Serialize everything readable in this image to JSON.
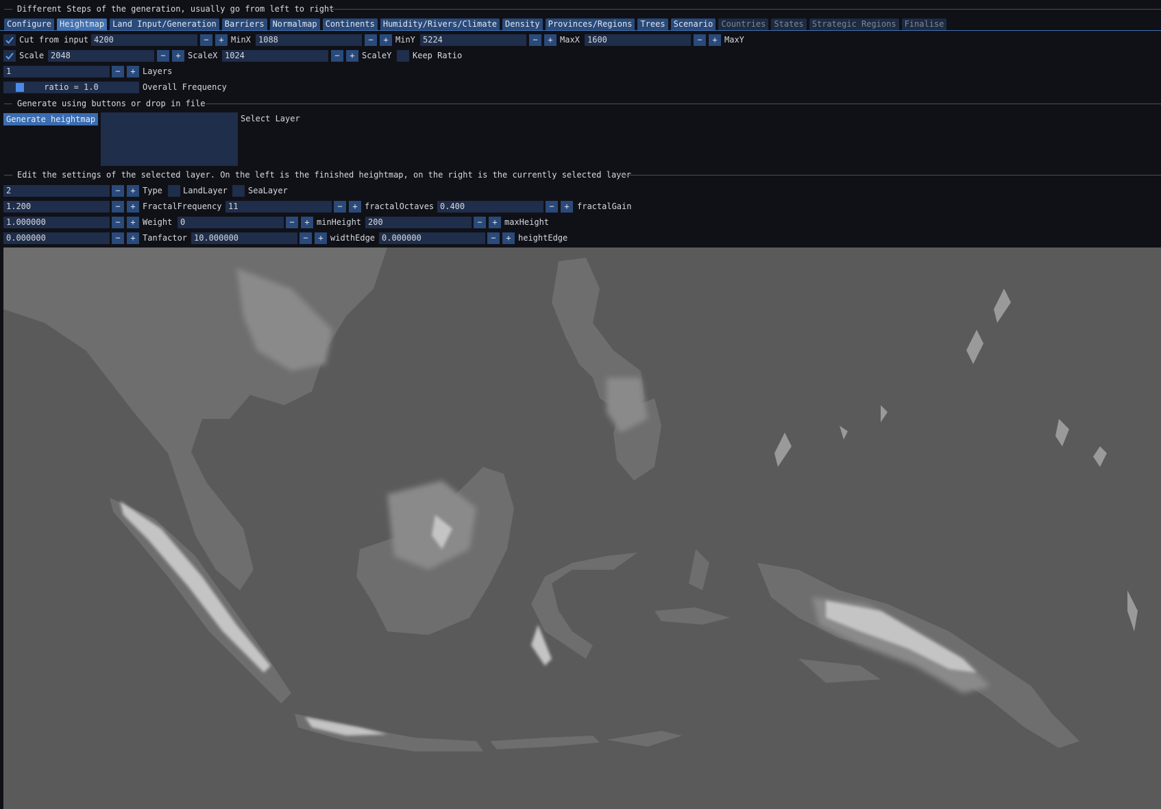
{
  "sections": {
    "steps": "Different Steps of the generation, usually go from left to right",
    "generate": "Generate using buttons or drop in file",
    "edit": "Edit the settings of the selected layer. On the left is the finished heightmap, on the right is the currently selected layer"
  },
  "tabs": [
    {
      "label": "Configure",
      "state": "enabled"
    },
    {
      "label": "Heightmap",
      "state": "active"
    },
    {
      "label": "Land Input/Generation",
      "state": "enabled"
    },
    {
      "label": "Barriers",
      "state": "enabled"
    },
    {
      "label": "Normalmap",
      "state": "enabled"
    },
    {
      "label": "Continents",
      "state": "enabled"
    },
    {
      "label": "Humidity/Rivers/Climate",
      "state": "enabled"
    },
    {
      "label": "Density",
      "state": "enabled"
    },
    {
      "label": "Provinces/Regions",
      "state": "enabled"
    },
    {
      "label": "Trees",
      "state": "enabled"
    },
    {
      "label": "Scenario",
      "state": "enabled"
    },
    {
      "label": "Countries",
      "state": "disabled"
    },
    {
      "label": "States",
      "state": "disabled"
    },
    {
      "label": "Strategic Regions",
      "state": "disabled"
    },
    {
      "label": "Finalise",
      "state": "disabled"
    }
  ],
  "buttons": {
    "minus": "−",
    "plus": "+"
  },
  "cut": {
    "checked": true,
    "label": "Cut from input",
    "fields": [
      {
        "value": "4200",
        "label": "MinX"
      },
      {
        "value": "1088",
        "label": "MinY"
      },
      {
        "value": "5224",
        "label": "MaxX"
      },
      {
        "value": "1600",
        "label": "MaxY"
      }
    ]
  },
  "scale": {
    "checked": true,
    "label": "Scale",
    "fields": [
      {
        "value": "2048",
        "label": "ScaleX"
      },
      {
        "value": "1024",
        "label": "ScaleY"
      }
    ],
    "keep_ratio": {
      "label": "Keep Ratio",
      "checked": false
    }
  },
  "layers": {
    "value": "1",
    "label": "Layers"
  },
  "frequency": {
    "text": "ratio = 1.0",
    "label": "Overall Frequency"
  },
  "generate": {
    "button": "Generate heightmap",
    "select_label": "Select Layer"
  },
  "layer_settings": {
    "type": {
      "value": "2",
      "label": "Type"
    },
    "land_layer": {
      "label": "LandLayer",
      "checked": false
    },
    "sea_layer": {
      "label": "SeaLayer",
      "checked": false
    },
    "row2": [
      {
        "value": "1.200",
        "label": "FractalFrequency"
      },
      {
        "value": "11",
        "label": "fractalOctaves"
      },
      {
        "value": "0.400",
        "label": "fractalGain"
      }
    ],
    "row3": [
      {
        "value": "1.000000",
        "label": "Weight"
      },
      {
        "value": "0",
        "label": "minHeight"
      },
      {
        "value": "200",
        "label": "maxHeight"
      }
    ],
    "row4": [
      {
        "value": "0.000000",
        "label": "Tanfactor"
      },
      {
        "value": "10.000000",
        "label": "widthEdge"
      },
      {
        "value": "0.000000",
        "label": "heightEdge"
      }
    ]
  },
  "colors": {
    "accent": "#4272b2",
    "button": "#294a7a",
    "field": "#1f2e4a",
    "background": "#101117",
    "map_sea": "#5a5a5a"
  }
}
